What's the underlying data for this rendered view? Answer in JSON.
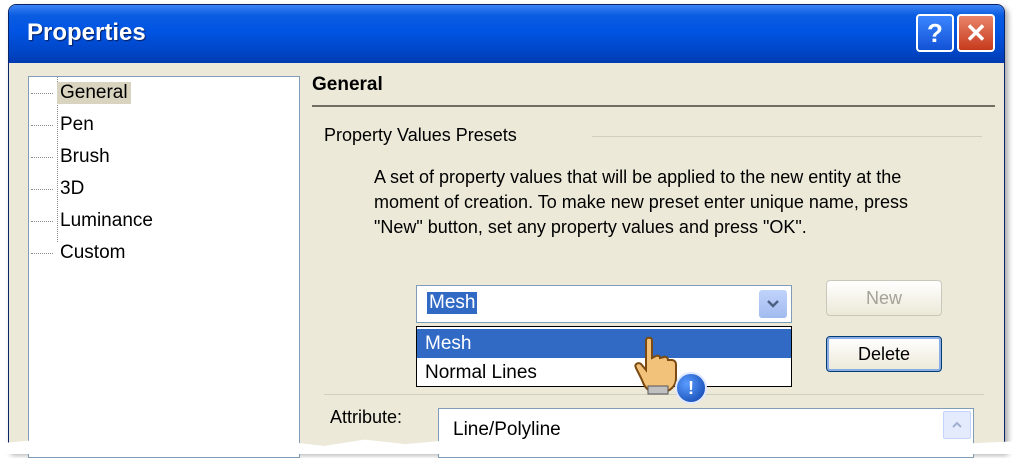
{
  "window": {
    "title": "Properties",
    "help_label": "?",
    "close_label": "✕"
  },
  "tree": {
    "items": [
      {
        "label": "General",
        "selected": true
      },
      {
        "label": "Pen"
      },
      {
        "label": "Brush"
      },
      {
        "label": "3D"
      },
      {
        "label": "Luminance"
      },
      {
        "label": "Custom"
      }
    ]
  },
  "panel": {
    "title": "General",
    "group_label": "Property Values Presets",
    "description": "A set of property values that will be applied to the new entity at the moment of creation. To make new preset enter unique name, press \"New\" button, set any property values and press \"OK\".",
    "combo_value": "Mesh",
    "dropdown_options": [
      "Mesh",
      "Normal Lines"
    ],
    "new_button": "New",
    "delete_button": "Delete",
    "attribute_label": "Attribute:",
    "attribute_value": "Line/Polyline"
  },
  "colors": {
    "titlebar": "#0054e3",
    "selection": "#316ac5",
    "window_bg": "#ece9d8"
  },
  "icons": {
    "help": "question-icon",
    "close": "close-icon",
    "combo_arrow": "chevron-down-icon",
    "cursor": "hand-pointer-icon",
    "badge": "info-badge-icon"
  }
}
